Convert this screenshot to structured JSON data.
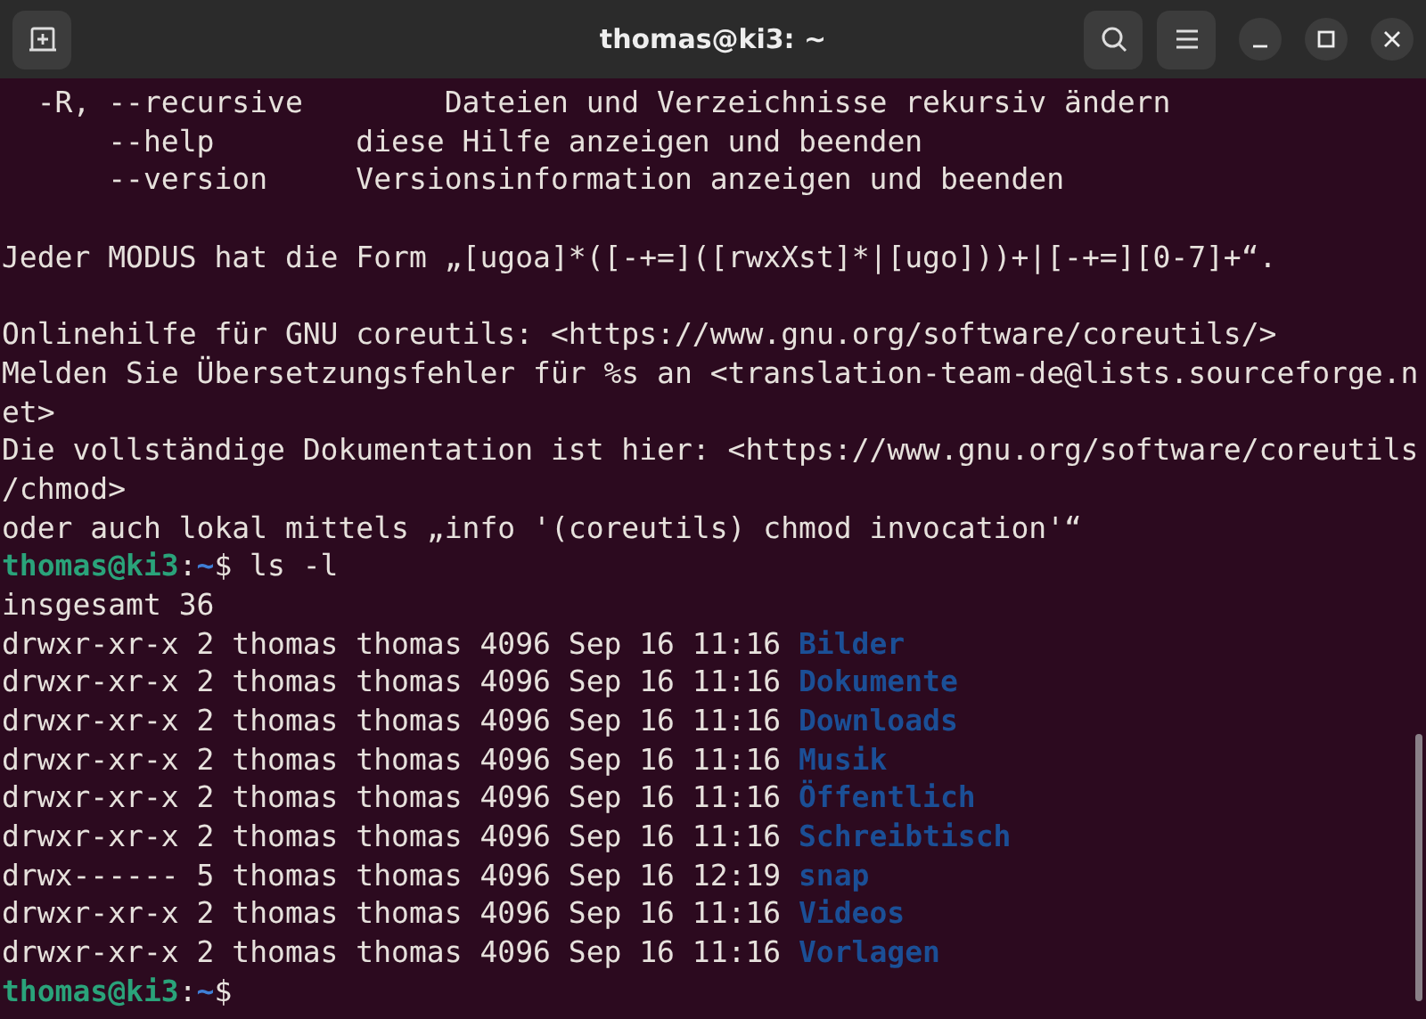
{
  "window": {
    "title": "thomas@ki3: ~"
  },
  "lines": [
    {
      "kind": "text",
      "text": "  -R, --recursive        Dateien und Verzeichnisse rekursiv ändern"
    },
    {
      "kind": "text",
      "text": "      --help        diese Hilfe anzeigen und beenden"
    },
    {
      "kind": "text",
      "text": "      --version     Versionsinformation anzeigen und beenden"
    },
    {
      "kind": "blank"
    },
    {
      "kind": "text",
      "text": "Jeder MODUS hat die Form „[ugoa]*([-+=]([rwxXst]*|[ugo]))+|[-+=][0-7]+“."
    },
    {
      "kind": "blank"
    },
    {
      "kind": "text",
      "text": "Onlinehilfe für GNU coreutils: <https://www.gnu.org/software/coreutils/>"
    },
    {
      "kind": "text",
      "text": "Melden Sie Übersetzungsfehler für %s an <translation-team-de@lists.sourceforge.n"
    },
    {
      "kind": "text",
      "text": "et>"
    },
    {
      "kind": "text",
      "text": "Die vollständige Dokumentation ist hier: <https://www.gnu.org/software/coreutils"
    },
    {
      "kind": "text",
      "text": "/chmod>"
    },
    {
      "kind": "text",
      "text": "oder auch lokal mittels „info '(coreutils) chmod invocation'“"
    },
    {
      "kind": "prompt",
      "user": "thomas@ki3",
      "sep": ":",
      "path": "~",
      "symbol": "$",
      "command": "ls -l"
    },
    {
      "kind": "text",
      "text": "insgesamt 36"
    },
    {
      "kind": "listing",
      "info": "drwxr-xr-x 2 thomas thomas 4096 Sep 16 11:16",
      "name": "Bilder"
    },
    {
      "kind": "listing",
      "info": "drwxr-xr-x 2 thomas thomas 4096 Sep 16 11:16",
      "name": "Dokumente"
    },
    {
      "kind": "listing",
      "info": "drwxr-xr-x 2 thomas thomas 4096 Sep 16 11:16",
      "name": "Downloads"
    },
    {
      "kind": "listing",
      "info": "drwxr-xr-x 2 thomas thomas 4096 Sep 16 11:16",
      "name": "Musik"
    },
    {
      "kind": "listing",
      "info": "drwxr-xr-x 2 thomas thomas 4096 Sep 16 11:16",
      "name": "Öffentlich"
    },
    {
      "kind": "listing",
      "info": "drwxr-xr-x 2 thomas thomas 4096 Sep 16 11:16",
      "name": "Schreibtisch"
    },
    {
      "kind": "listing",
      "info": "drwx------ 5 thomas thomas 4096 Sep 16 12:19",
      "name": "snap"
    },
    {
      "kind": "listing",
      "info": "drwxr-xr-x 2 thomas thomas 4096 Sep 16 11:16",
      "name": "Videos"
    },
    {
      "kind": "listing",
      "info": "drwxr-xr-x 2 thomas thomas 4096 Sep 16 11:16",
      "name": "Vorlagen"
    },
    {
      "kind": "prompt",
      "user": "thomas@ki3",
      "sep": ":",
      "path": "~",
      "symbol": "$"
    }
  ]
}
